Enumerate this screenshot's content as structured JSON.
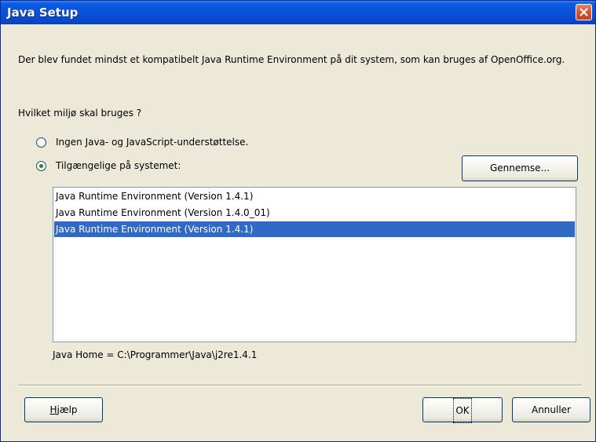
{
  "window": {
    "title": "Java Setup"
  },
  "dialog": {
    "description": "Der blev fundet mindst et kompatibelt Java Runtime Environment på dit system, som kan bruges af OpenOffice.org.",
    "question": "Hvilket miljø skal bruges ?"
  },
  "options": {
    "no_java_label": "Ingen Java- og JavaScript-understøttelse.",
    "available_label": "Tilgængelige på systemet:",
    "selected": "available"
  },
  "buttons": {
    "browse": "Gennemse...",
    "help_first": "H",
    "help_rest": "jælp",
    "ok": "OK",
    "cancel": "Annuller"
  },
  "jre_list": {
    "items": [
      "Java Runtime Environment (Version 1.4.1)",
      "Java Runtime Environment (Version 1.4.0_01)",
      "Java Runtime Environment (Version 1.4.1)"
    ],
    "selected_index": 2
  },
  "java_home": "Java Home = C:\\Programmer\\Java\\j2re1.4.1",
  "colors": {
    "title_bar": "#0a52d8",
    "selection": "#316ac5",
    "dialog_bg": "#ece9d8",
    "close_button": "#d9542f"
  }
}
